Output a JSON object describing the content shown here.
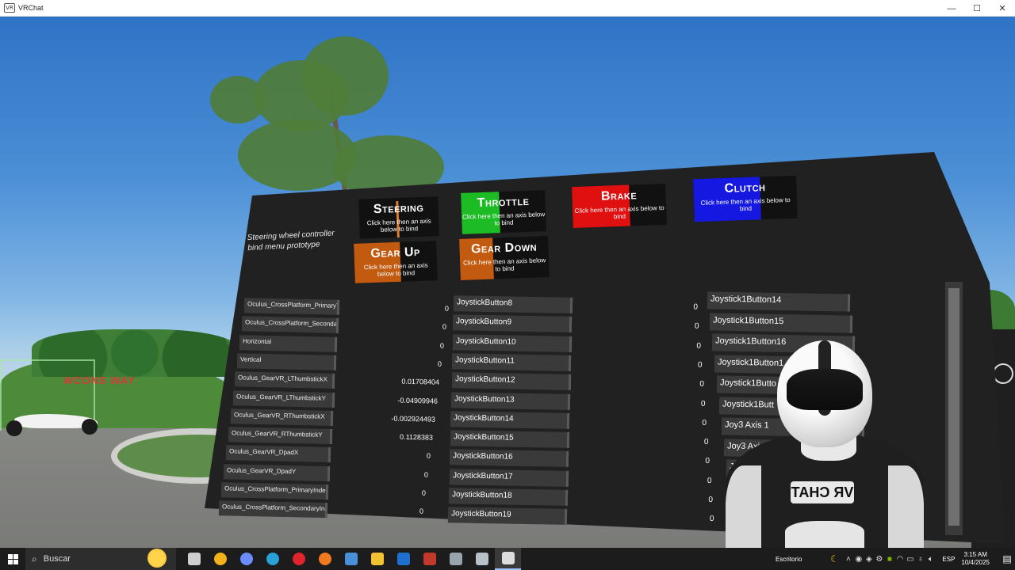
{
  "window": {
    "title": "VRChat",
    "app_icon": "VR",
    "buttons": {
      "minimize": "—",
      "maximize": "☐",
      "close": "✕"
    }
  },
  "scene": {
    "sign_text": "WCONS WAY"
  },
  "board": {
    "label": "Steering wheel controller bind menu prototype",
    "bindings": [
      {
        "name": "Steering",
        "hint": "Click here then an axis below to bind",
        "color": "#e07b2a"
      },
      {
        "name": "Throttle",
        "hint": "Click here then an axis below to bind",
        "color": "#1dbb24"
      },
      {
        "name": "Brake",
        "hint": "Click here then an axis below to bind",
        "color": "#e01010"
      },
      {
        "name": "Clutch",
        "hint": "Click here then an axis below to bind",
        "color": "#1418e0"
      },
      {
        "name": "Gear Up",
        "hint": "Click here then an axis below to bind",
        "color": "#c25a10"
      },
      {
        "name": "Gear Down",
        "hint": "Click here then an axis below to bind",
        "color": "#c25a10"
      }
    ],
    "axes": [
      {
        "label": "Oculus_CrossPlatform_PrimaryThumbstick",
        "value": "0"
      },
      {
        "label": "Oculus_CrossPlatform_SecondaryThumbstick",
        "value": "0"
      },
      {
        "label": "Horizontal",
        "value": "0"
      },
      {
        "label": "Vertical",
        "value": "0"
      },
      {
        "label": "Oculus_GearVR_LThumbstickX",
        "value": "0.01708404"
      },
      {
        "label": "Oculus_GearVR_LThumbstickY",
        "value": "-0.04909946"
      },
      {
        "label": "Oculus_GearVR_RThumbstickX",
        "value": "-0.002924493"
      },
      {
        "label": "Oculus_GearVR_RThumbstickY",
        "value": "0.1128383"
      },
      {
        "label": "Oculus_GearVR_DpadX",
        "value": "0"
      },
      {
        "label": "Oculus_GearVR_DpadY",
        "value": "0"
      },
      {
        "label": "Oculus_CrossPlatform_PrimaryIndexTrigger",
        "value": "0"
      },
      {
        "label": "Oculus_CrossPlatform_SecondaryIndexTrigger",
        "value": "0"
      }
    ],
    "buttons_col1": [
      {
        "label": "JoystickButton8",
        "value": "0"
      },
      {
        "label": "JoystickButton9",
        "value": "0"
      },
      {
        "label": "JoystickButton10",
        "value": "0"
      },
      {
        "label": "JoystickButton11",
        "value": "0"
      },
      {
        "label": "JoystickButton12",
        "value": "0"
      },
      {
        "label": "JoystickButton13",
        "value": "0"
      },
      {
        "label": "JoystickButton14",
        "value": "0"
      },
      {
        "label": "JoystickButton15",
        "value": "0"
      },
      {
        "label": "JoystickButton16",
        "value": "0"
      },
      {
        "label": "JoystickButton17",
        "value": "0"
      },
      {
        "label": "JoystickButton18",
        "value": "0"
      },
      {
        "label": "JoystickButton19",
        "value": "0"
      }
    ],
    "buttons_col2": [
      {
        "label": "Joystick1Button14"
      },
      {
        "label": "Joystick1Button15"
      },
      {
        "label": "Joystick1Button16"
      },
      {
        "label": "Joystick1Button1"
      },
      {
        "label": "Joystick1Butto"
      },
      {
        "label": "Joystick1Butt"
      },
      {
        "label": "Joy3 Axis 1"
      },
      {
        "label": "Joy3 Axis 2"
      },
      {
        "label": "Joy"
      }
    ]
  },
  "avatar": {
    "chest_logo": "VR CHAT"
  },
  "taskbar": {
    "search_placeholder": "Buscar",
    "desktop_label": "Escritorio",
    "language": "ESP",
    "time": "3:15 AM",
    "date": "10/4/2025",
    "apps": [
      {
        "icon": "task-view-icon",
        "color": "#cfcfcf"
      },
      {
        "icon": "chrome-icon",
        "color": "#f2b21b"
      },
      {
        "icon": "copilot-icon",
        "color": "#6a8cff"
      },
      {
        "icon": "edge-icon",
        "color": "#2aa0d8"
      },
      {
        "icon": "opera-icon",
        "color": "#e0242b"
      },
      {
        "icon": "firefox-icon",
        "color": "#f07a1f"
      },
      {
        "icon": "media-icon",
        "color": "#4a90d9"
      },
      {
        "icon": "file-explorer-icon",
        "color": "#f1c232"
      },
      {
        "icon": "outlook-icon",
        "color": "#1f6fd1"
      },
      {
        "icon": "stream-icon",
        "color": "#c0392b"
      },
      {
        "icon": "app-icon",
        "color": "#9aa4ad"
      },
      {
        "icon": "shield-icon",
        "color": "#b9c1c8"
      },
      {
        "icon": "vrchat-icon",
        "color": "#dddddd"
      }
    ]
  }
}
